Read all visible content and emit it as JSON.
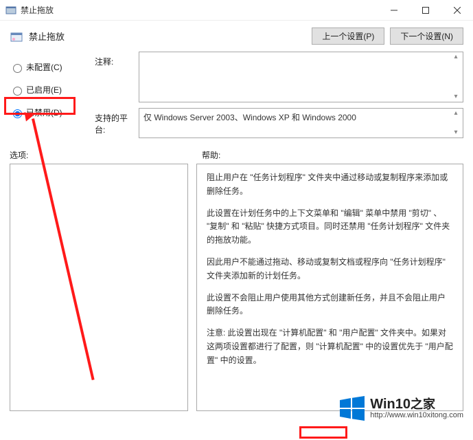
{
  "titlebar": {
    "title": "禁止拖放"
  },
  "header": {
    "title": "禁止拖放",
    "prev_btn": "上一个设置(P)",
    "next_btn": "下一个设置(N)"
  },
  "radios": {
    "not_configured": "未配置(C)",
    "enabled": "已启用(E)",
    "disabled": "已禁用(D)",
    "selected": "disabled"
  },
  "labels": {
    "comment": "注释:",
    "platform": "支持的平台:",
    "options": "选项:",
    "help": "帮助:"
  },
  "platform_text": "仅 Windows Server 2003、Windows XP 和 Windows 2000",
  "help": {
    "p1": "阻止用户在 \"任务计划程序\" 文件夹中通过移动或复制程序来添加或删除任务。",
    "p2": "此设置在计划任务中的上下文菜单和 \"编辑\" 菜单中禁用 \"剪切\" 、 \"复制\" 和 \"粘贴\" 快捷方式项目。同时还禁用 \"任务计划程序\" 文件夹的拖放功能。",
    "p3": "因此用户不能通过拖动、移动或复制文档或程序向 \"任务计划程序\" 文件夹添加新的计划任务。",
    "p4": "此设置不会阻止用户使用其他方式创建新任务，并且不会阻止用户删除任务。",
    "p5": "注意: 此设置出现在 \"计算机配置\" 和 \"用户配置\" 文件夹中。如果对这两项设置都进行了配置，则 \"计算机配置\" 中的设置优先于 \"用户配置\" 中的设置。"
  },
  "watermark": {
    "brand": "Win10",
    "brand_suffix": "之家",
    "url": "http://www.win10xitong.com"
  }
}
